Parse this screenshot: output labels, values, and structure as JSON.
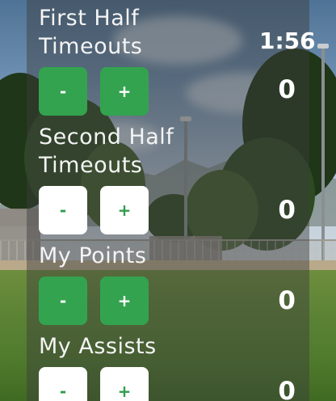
{
  "clock": {
    "time": "1:56"
  },
  "sections": {
    "first_half_timeouts": {
      "label_line1": "First Half",
      "label_line2": "Timeouts",
      "minus_label": "-",
      "plus_label": "+",
      "count": "0"
    },
    "second_half_timeouts": {
      "label_line1": "Second Half",
      "label_line2": "Timeouts",
      "minus_label": "-",
      "plus_label": "+",
      "count": "0"
    },
    "my_points": {
      "label": "My Points",
      "minus_label": "-",
      "plus_label": "+",
      "count": "0"
    },
    "my_assists": {
      "label": "My Assists",
      "minus_label": "-",
      "plus_label": "+",
      "count": "0"
    }
  },
  "colors": {
    "button_green": "#34a34f",
    "button_white": "#ffffff",
    "panel_overlay": "rgba(60,60,60,0.45)"
  }
}
